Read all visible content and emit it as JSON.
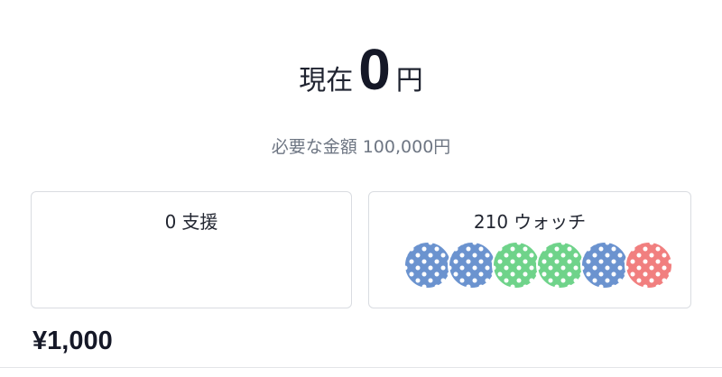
{
  "funding": {
    "current_prefix": "現在",
    "current_amount": "0",
    "current_unit": "円",
    "goal_label": "必要な金額",
    "goal_amount": "100,000円"
  },
  "stats": {
    "supporters_count": "0",
    "supporters_label": "支援",
    "watchers_count": "210",
    "watchers_label": "ウォッチ",
    "watcher_avatars": [
      {
        "icon": "polka-dot-avatar-icon",
        "color": "#6b93cf"
      },
      {
        "icon": "polka-dot-avatar-icon",
        "color": "#6b93cf"
      },
      {
        "icon": "polka-dot-avatar-icon",
        "color": "#6fd38a"
      },
      {
        "icon": "polka-dot-avatar-icon",
        "color": "#6fd38a"
      },
      {
        "icon": "polka-dot-avatar-icon",
        "color": "#6b93cf"
      },
      {
        "icon": "polka-dot-avatar-icon",
        "color": "#f17f7f"
      }
    ]
  },
  "reward": {
    "price": "¥1,000"
  }
}
